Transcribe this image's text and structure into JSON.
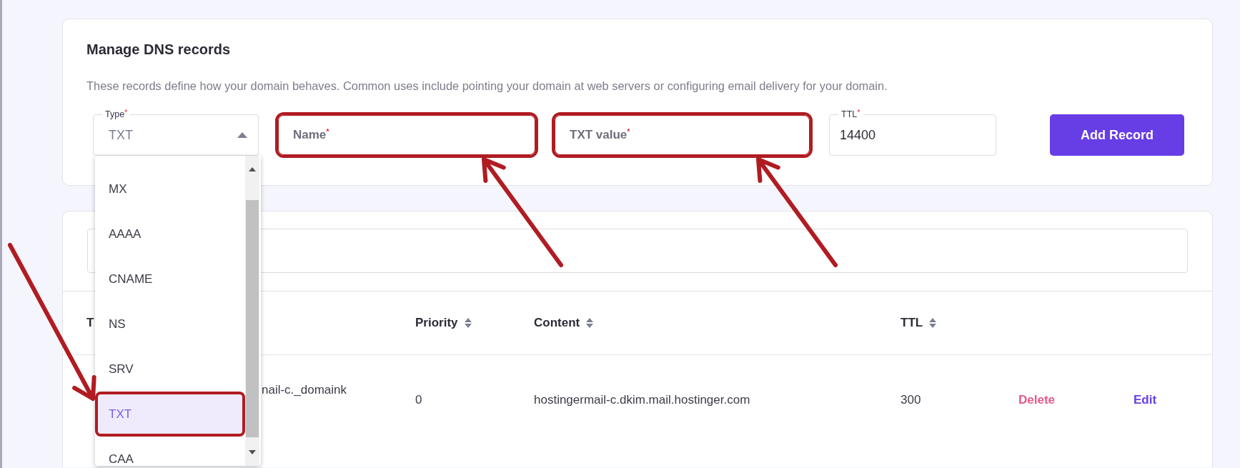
{
  "dns_card": {
    "title": "Manage DNS records",
    "description": "These records define how your domain behaves. Common uses include pointing your domain at web servers or configuring email delivery for your domain.",
    "fields": [
      {
        "kind": "select",
        "label": "Type",
        "required_mark": "*",
        "value": "TXT",
        "expanded": true,
        "highlighted": false
      },
      {
        "kind": "text",
        "placeholder": "Name",
        "required_mark": "*",
        "highlighted": true
      },
      {
        "kind": "text",
        "placeholder": "TXT value",
        "required_mark": "*",
        "highlighted": true
      },
      {
        "kind": "labeled",
        "label": "TTL",
        "required_mark": "*",
        "value": "14400",
        "highlighted": false
      }
    ],
    "button": "Add Record"
  },
  "type_dropdown": {
    "options": [
      {
        "label": "MX",
        "selected": false,
        "highlighted": false
      },
      {
        "label": "AAAA",
        "selected": false,
        "highlighted": false
      },
      {
        "label": "CNAME",
        "selected": false,
        "highlighted": false
      },
      {
        "label": "NS",
        "selected": false,
        "highlighted": false
      },
      {
        "label": "SRV",
        "selected": false,
        "highlighted": false
      },
      {
        "label": "TXT",
        "selected": true,
        "highlighted": true
      },
      {
        "label": "CAA",
        "selected": false,
        "highlighted": false
      }
    ]
  },
  "annotation_arrows": [
    {
      "kind": "from-below"
    },
    {
      "kind": "from-below"
    },
    {
      "kind": "from-left"
    }
  ],
  "records_card": {
    "filter_field": {
      "kind": "search"
    },
    "columns": [
      {
        "label": "T"
      },
      {
        "label": "Priority",
        "sortable": true
      },
      {
        "label": "Content",
        "sortable": true
      },
      {
        "label": "TTL",
        "sortable": true
      }
    ],
    "rows": [
      {
        "cells": [
          "nail-c._domaink",
          "0",
          "hostingermail-c.dkim.mail.hostinger.com",
          "300"
        ],
        "actions": [
          {
            "label": "Delete",
            "kind": "danger"
          },
          {
            "label": "Edit",
            "kind": "primary"
          }
        ]
      }
    ]
  }
}
